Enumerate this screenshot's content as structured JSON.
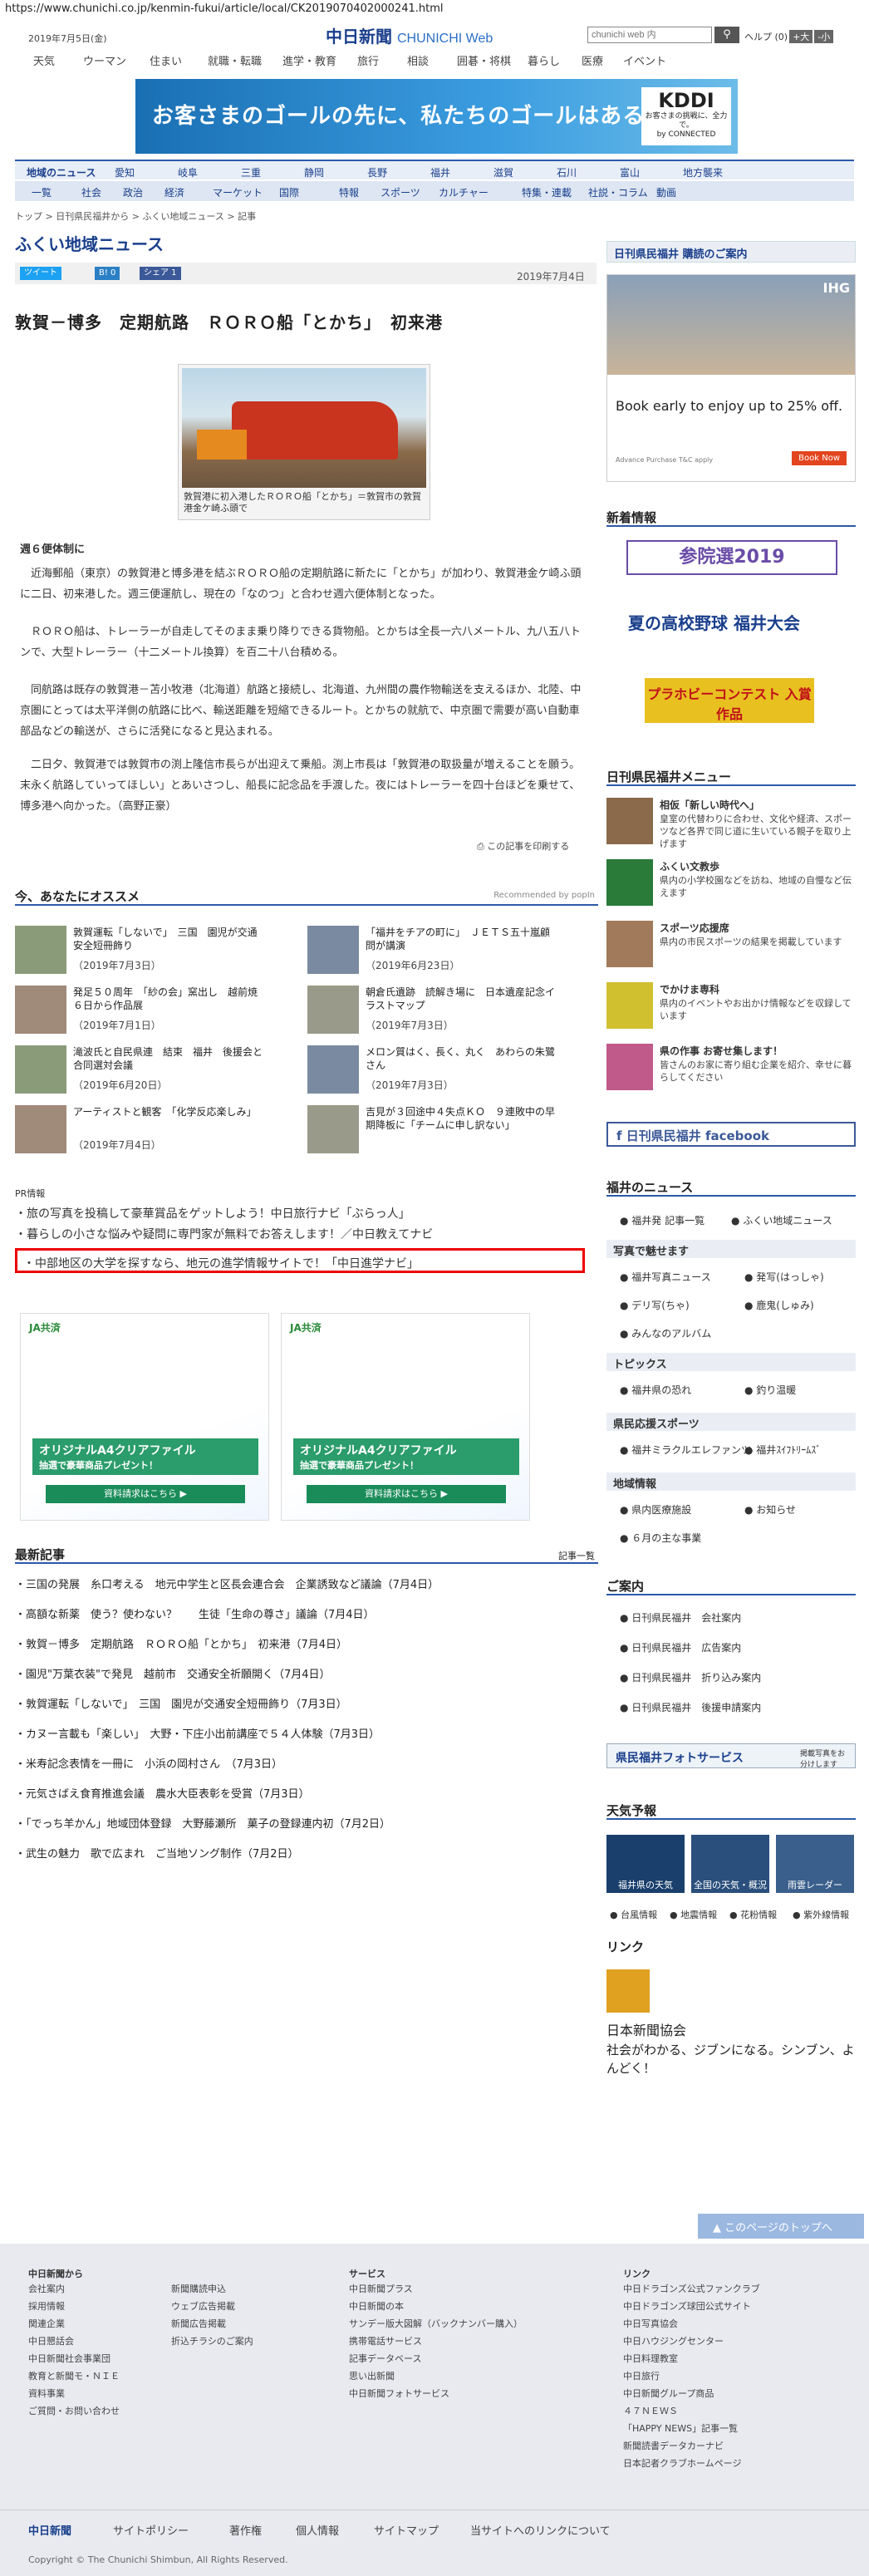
{
  "browser": {
    "url": "https://www.chunichi.co.jp/kenmin-fukui/article/local/CK2019070402000241.html"
  },
  "header": {
    "date": "2019年7月5日(金)",
    "logo": "中日新聞",
    "logo_web": "CHUNICHI Web",
    "search_placeholder": "chunichi web 内",
    "search_icon": "magnifier-icon",
    "tool_text": "ヘルプ (0)",
    "font_large": "+大",
    "font_small": "-小"
  },
  "global_nav": [
    "天気",
    "ウーマン",
    "住まい",
    "就職・転職",
    "進学・教育",
    "旅行",
    "相談",
    "囲碁・将棋",
    "暮らし",
    "医療",
    "イベント"
  ],
  "top_ad": {
    "text": "お客さまのゴールの先に、私たちのゴールはある。",
    "brand": "KDDI",
    "sub": "お客さまの挑戦に、全力で。",
    "tag": "by CONNECTED"
  },
  "cat_nav1": [
    "地域のニュース",
    "愛知",
    "岐阜",
    "三重",
    "静岡",
    "長野",
    "福井",
    "滋賀",
    "石川",
    "富山",
    "地方襲来"
  ],
  "cat_nav2": [
    "一覧",
    "社会",
    "政治",
    "経済",
    "マーケット",
    "国際",
    "特報",
    "スポーツ",
    "カルチャー",
    "特集・連載",
    "社説・コラム",
    "動画"
  ],
  "breadcrumb": "トップ > 日刊県民福井から > ふくい地域ニュース > 記事",
  "section_title": "ふくい地域ニュース",
  "share": {
    "tweet": "ツイート",
    "b": "B! 0",
    "fb": "シェア 1"
  },
  "pub_date": "2019年7月4日",
  "article": {
    "title": "敦賀－博多　定期航路　ＲＯＲＯ船「とかち」　初来港",
    "photo_caption": "敦賀港に初入港したＲＯＲＯ船「とかち」＝敦賀市の敦賀港金ケ崎ふ頭で",
    "subhead": "週６便体制に",
    "p1": "近海郵船（東京）の敦賀港と博多港を結ぶＲＯＲＯ船の定期航路に新たに「とかち」が加わり、敦賀港金ケ崎ふ頭に二日、初来港した。週三便運航し、現在の「なのつ」と合わせ週六便体制となった。",
    "p2": "ＲＯＲＯ船は、トレーラーが自走してそのまま乗り降りできる貨物船。とかちは全長一六八メートル、九八五八トンで、大型トレーラー（十二メートル換算）を百二十八台積める。",
    "p3": "同航路は既存の敦賀港－苫小牧港（北海道）航路と接続し、北海道、九州間の農作物輸送を支えるほか、北陸、中京圏にとっては太平洋側の航路に比べ、輸送距離を短縮できるルート。とかちの就航で、中京圏で需要が高い自動車部品などの輸送が、さらに活発になると見込まれる。",
    "p4": "二日夕、敦賀港では敦賀市の渕上隆信市長らが出迎えて乗船。渕上市長は「敦賀港の取扱量が増えることを願う。末永く航路していってほしい」とあいさつし、船長に記念品を手渡した。夜にはトレーラーを四十台ほどを乗せて、博多港へ向かった。（高野正豪）",
    "print": "この記事を印刷する"
  },
  "recommend": {
    "title": "今、あなたにオススメ",
    "powered": "Recommended by popIn",
    "items": [
      {
        "t": "敦賀運転「しないで」　三国　園児が交通安全短冊飾り",
        "d": "（2019年7月3日）"
      },
      {
        "t": "「福井をチアの町に」　ＪＥＴＳ五十嵐顧問が講演",
        "d": "（2019年6月23日）"
      },
      {
        "t": "発足５０周年　「紗の会」窯出し　越前焼　６日から作品展",
        "d": "（2019年7月1日）"
      },
      {
        "t": "朝倉氏遺跡　読解き場に　日本遺産記念イラストマップ",
        "d": "（2019年7月3日）"
      },
      {
        "t": "滝波氏と自民県連　結束　福井　後援会と合同選対会議",
        "d": "（2019年6月20日）"
      },
      {
        "t": "メロン質はく、長く、丸く　あわらの朱鷺さん",
        "d": "（2019年7月3日）"
      },
      {
        "t": "アーティストと観客　「化学反応楽しみ」",
        "d": "（2019年7月4日）"
      },
      {
        "t": "吉見が３回途中４失点ＫＯ　９連敗中の早期降板に「チームに申し訳ない」",
        "d": ""
      }
    ]
  },
  "pr": {
    "label": "PR情報",
    "items": [
      "旅の写真を投稿して豪華賞品をゲットしよう！中日旅行ナビ「ぶらっ人」",
      "暮らしの小さな悩みや疑問に専門家が無料でお答えします！／中日教えてナビ",
      "中部地区の大学を探すなら、地元の進学情報サイトで！「中日進学ナビ」"
    ]
  },
  "ad_ja": {
    "brand": "JA共済",
    "card": "オリジナルA4クリアファイル",
    "sub": "抽選で豪華商品プレゼント！",
    "btn": "資料請求はこちら ▶"
  },
  "latest": {
    "title": "最新記事",
    "more": "記事一覧",
    "items": [
      "三国の発展　糸口考える　地元中学生と区長会連合会　企業誘致など議論（7月4日）",
      "高額な新薬　使う？使わない？　　生徒「生命の尊さ」議論（7月4日）",
      "敦賀－博多　定期航路　ＲＯＲＯ船「とかち」　初来港（7月4日）",
      "園児\"万葉衣装\"で発見　越前市　交通安全祈願開く（7月4日）",
      "敦賀運転「しないで」　三国　園児が交通安全短冊飾り（7月3日）",
      "カヌー言載も「楽しい」　大野・下庄小出前講座で５４人体験（7月3日）",
      "米寿記念表情を一冊に　小浜の岡村さん　（7月3日）",
      "元気さばえ食育推進会議　農水大臣表彰を受賞（7月3日）",
      "「でっち羊かん」地域団体登録　大野藤瀬所　菓子の登録連内初（7月2日）",
      "武生の魅力　歌で広まれ　ご当地ソング制作（7月2日）"
    ]
  },
  "right": {
    "subscribe": "日刊県民福井 購読のご案内",
    "ad_ihg": {
      "text": "Book early to enjoy up to 25% off.",
      "brand": "IHG",
      "fine": "Advance Purchase T&C apply",
      "btn": "Book Now"
    },
    "new_info": "新着情報",
    "sanin": "参院選2019",
    "koshien": "夏の高校野球 福井大会",
    "hobby": "プラホビーコンテスト 入賞作品",
    "menu_title": "日刊県民福井メニュー",
    "menu": [
      {
        "h": "相仮「新しい時代へ」",
        "d": "皇室の代替わりに合わせ、文化や経済、スポーツなど各界で同じ道に生いている親子を取り上げます"
      },
      {
        "h": "ふくい文教歩",
        "d": "県内の小学校園などを訪ね、地域の自慢など伝えます"
      },
      {
        "h": "スポーツ応援席",
        "d": "県内の市民スポーツの結果を掲載しています"
      },
      {
        "h": "でかけま専科",
        "d": "県内のイベントやお出かけ情報などを収録しています"
      },
      {
        "h": "県の作事 お寄せ集します！",
        "d": "皆さんのお家に寄り組む企業を紹介、幸せに暮らしてください"
      }
    ],
    "facebook": "日刊県民福井 facebook",
    "fukui_news": "福井のニュース",
    "news_links": [
      "福井発 記事一覧",
      "ふくい地域ニュース"
    ],
    "photo_hd": "写真で魅せます",
    "photo_links": [
      "福井写真ニュース",
      "発写(はっしゃ)",
      "デリ写(ちゃ)",
      "鹿鬼(しゅみ)",
      "みんなのアルバム"
    ],
    "topics_hd": "トピックス",
    "topics_links": [
      "福井県の恐れ",
      "釣り温暖"
    ],
    "sports_hd": "県民応援スポーツ",
    "sports_links": [
      "福井ミラクルエレファンツ",
      "福井ｽｲﾌﾄﾘｰﾑｽﾞ"
    ],
    "local_hd": "地域情報",
    "local_links": [
      "県内医療施設",
      "お知らせ",
      "６月の主な",
      "６月の主な事業"
    ],
    "guide_hd": "ご案内",
    "guide_links": [
      "日刊県民福井　会社案内",
      "日刊県民福井　広告案内",
      "日刊県民福井　折り込み案内",
      "日刊県民福井　後援申請案内"
    ],
    "photo_service": "県民福井フォトサービス",
    "photo_service_sub": "掲載写真をお分けします",
    "weather_hd": "天気予報",
    "weather": [
      "福井県の天気",
      "全国の天気・概況",
      "雨雲レーダー"
    ],
    "weather_links": [
      "台風情報",
      "地震情報",
      "花粉情報",
      "紫外線情報"
    ],
    "link_hd": "リンク",
    "jnpa": "日本新聞協会",
    "jnpa_sub": "社会がわかる、ジブンになる。シンブン、よんどく！"
  },
  "pagetop": "このページのトップへ",
  "footer": {
    "col1_hd": "中日新聞から",
    "col1": [
      "会社案内",
      "採用情報",
      "関連企業",
      "中日懇話会",
      "中日新聞社会事業団",
      "教育と新聞モ・ＮＩＥ",
      "資料事業",
      "ご質問・お問い合わせ"
    ],
    "col2": [
      "新聞購読申込",
      "ウェブ広告掲載",
      "新聞広告掲載",
      "折込チラシのご案内"
    ],
    "col3_hd": "サービス",
    "col3": [
      "中日新聞プラス",
      "中日新聞の本",
      "サンデー版大図解（バックナンバー購入）",
      "携帯電話サービス",
      "記事データベース",
      "思い出新聞",
      "中日新聞フォトサービス"
    ],
    "col4_hd": "リンク",
    "col4": [
      "中日ドラゴンズ公式ファンクラブ",
      "中日ドラゴンズ球団公式サイト",
      "中日写真協会",
      "中日ハウジングセンター",
      "中日料理教室",
      "中日旅行",
      "中日新聞グループ商品",
      "４７ＮＥＷＳ",
      "「HAPPY NEWS」記事一覧",
      "新聞読書データカーナビ",
      "日本記者クラブホームページ"
    ],
    "bar": [
      "中日新聞",
      "サイトポリシー",
      "著作権",
      "個人情報",
      "サイトマップ",
      "当サイトへのリンクについて"
    ],
    "copyright": "Copyright © The Chunichi Shimbun, All Rights Reserved."
  }
}
